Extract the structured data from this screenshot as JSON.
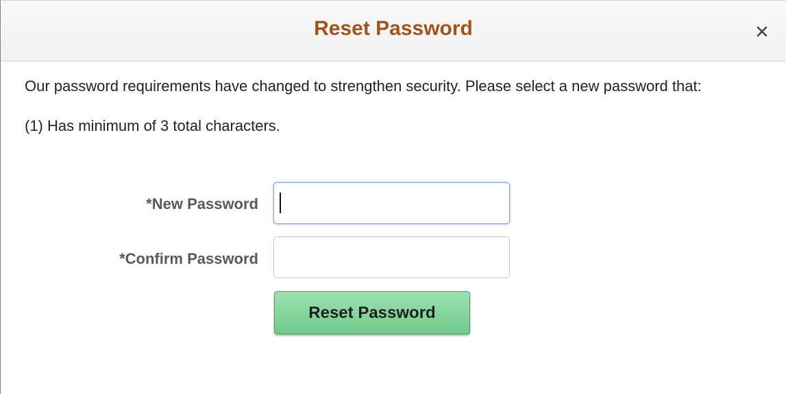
{
  "dialog": {
    "title": "Reset Password",
    "close_icon": "close-icon"
  },
  "content": {
    "message": "Our password requirements have changed to strengthen security. Please select a new password that:",
    "requirement": "(1) Has minimum of 3 total characters."
  },
  "form": {
    "new_password": {
      "label": "*New Password",
      "value": ""
    },
    "confirm_password": {
      "label": "*Confirm Password",
      "value": ""
    },
    "submit_label": "Reset Password"
  },
  "colors": {
    "title": "#a0541b",
    "button_top": "#9ee0b2",
    "button_bottom": "#6fcb8a",
    "focus_border": "#7ba6d9"
  }
}
